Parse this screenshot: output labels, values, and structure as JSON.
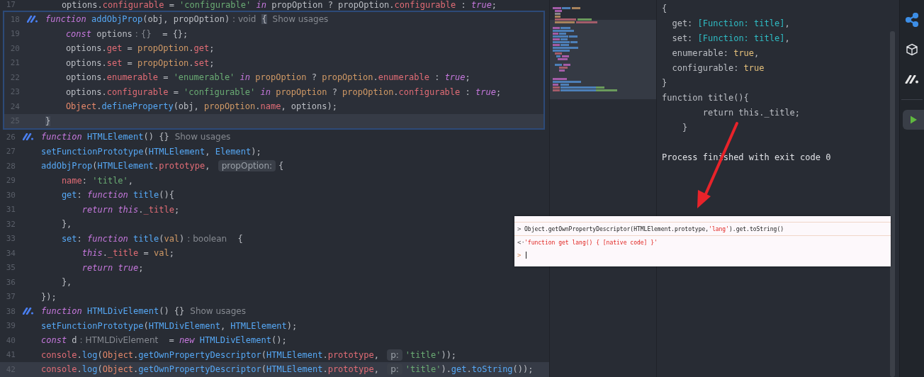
{
  "editor": {
    "top_line": {
      "number": "17",
      "tokens": [
        {
          "kind": "plain",
          "text": "    options."
        },
        {
          "kind": "prop",
          "text": "configurable"
        },
        {
          "kind": "plain",
          "text": " = "
        },
        {
          "kind": "str",
          "text": "'configurable'"
        },
        {
          "kind": "kw",
          "text": " in"
        },
        {
          "kind": "plain",
          "text": " propOption ? propOption."
        },
        {
          "kind": "prop",
          "text": "configurable"
        },
        {
          "kind": "plain",
          "text": " : "
        },
        {
          "kind": "kw",
          "text": "true"
        },
        {
          "kind": "plain",
          "text": ";"
        }
      ]
    },
    "popup_lines": [
      {
        "number": "18",
        "marker": true,
        "current": false,
        "tokens": [
          {
            "kind": "kw",
            "text": "function"
          },
          {
            "kind": "fn",
            "text": " addObjProp"
          },
          {
            "kind": "plain",
            "text": "(obj, propOption)"
          },
          {
            "kind": "hint",
            "text": ": void"
          },
          {
            "kind": "match",
            "text": "{"
          },
          {
            "kind": "usages",
            "text": "Show usages"
          }
        ]
      },
      {
        "number": "19",
        "marker": false,
        "current": false,
        "tokens": [
          {
            "kind": "kw",
            "text": "    const"
          },
          {
            "kind": "plain",
            "text": " options"
          },
          {
            "kind": "hint",
            "text": ": {}"
          },
          {
            "kind": "plain",
            "text": " = {};"
          }
        ]
      },
      {
        "number": "20",
        "marker": false,
        "current": false,
        "tokens": [
          {
            "kind": "plain",
            "text": "    options."
          },
          {
            "kind": "prop",
            "text": "get"
          },
          {
            "kind": "plain",
            "text": " = "
          },
          {
            "kind": "param",
            "text": "propOption"
          },
          {
            "kind": "plain",
            "text": "."
          },
          {
            "kind": "prop",
            "text": "get"
          },
          {
            "kind": "plain",
            "text": ";"
          }
        ]
      },
      {
        "number": "21",
        "marker": false,
        "current": false,
        "tokens": [
          {
            "kind": "plain",
            "text": "    options."
          },
          {
            "kind": "prop",
            "text": "set"
          },
          {
            "kind": "plain",
            "text": " = "
          },
          {
            "kind": "param",
            "text": "propOption"
          },
          {
            "kind": "plain",
            "text": "."
          },
          {
            "kind": "prop",
            "text": "set"
          },
          {
            "kind": "plain",
            "text": ";"
          }
        ]
      },
      {
        "number": "22",
        "marker": false,
        "current": false,
        "tokens": [
          {
            "kind": "plain",
            "text": "    options."
          },
          {
            "kind": "prop",
            "text": "enumerable"
          },
          {
            "kind": "plain",
            "text": " = "
          },
          {
            "kind": "str",
            "text": "'enumerable'"
          },
          {
            "kind": "kw",
            "text": " in"
          },
          {
            "kind": "param",
            "text": " propOption"
          },
          {
            "kind": "plain",
            "text": " ? "
          },
          {
            "kind": "param",
            "text": "propOption"
          },
          {
            "kind": "plain",
            "text": "."
          },
          {
            "kind": "prop",
            "text": "enumerable"
          },
          {
            "kind": "plain",
            "text": " : "
          },
          {
            "kind": "kw",
            "text": "true"
          },
          {
            "kind": "plain",
            "text": ";"
          }
        ]
      },
      {
        "number": "23",
        "marker": false,
        "current": false,
        "tokens": [
          {
            "kind": "plain",
            "text": "    options."
          },
          {
            "kind": "prop",
            "text": "configurable"
          },
          {
            "kind": "plain",
            "text": " = "
          },
          {
            "kind": "str",
            "text": "'configurable'"
          },
          {
            "kind": "kw",
            "text": " in"
          },
          {
            "kind": "param",
            "text": " propOption"
          },
          {
            "kind": "plain",
            "text": " ? "
          },
          {
            "kind": "param",
            "text": "propOption"
          },
          {
            "kind": "plain",
            "text": "."
          },
          {
            "kind": "prop",
            "text": "configurable"
          },
          {
            "kind": "plain",
            "text": " : "
          },
          {
            "kind": "kw",
            "text": "true"
          },
          {
            "kind": "plain",
            "text": ";"
          }
        ]
      },
      {
        "number": "24",
        "marker": false,
        "current": false,
        "tokens": [
          {
            "kind": "obj",
            "text": "    Object"
          },
          {
            "kind": "plain",
            "text": "."
          },
          {
            "kind": "fn",
            "text": "defineProperty"
          },
          {
            "kind": "plain",
            "text": "(obj, "
          },
          {
            "kind": "param",
            "text": "propOption"
          },
          {
            "kind": "plain",
            "text": "."
          },
          {
            "kind": "prop",
            "text": "name"
          },
          {
            "kind": "plain",
            "text": ", options);"
          }
        ]
      },
      {
        "number": "25",
        "marker": false,
        "current": true,
        "tokens": [
          {
            "kind": "match",
            "text": "}"
          }
        ]
      }
    ],
    "lines": [
      {
        "number": "26",
        "marker": true,
        "current": false,
        "tokens": [
          {
            "kind": "kw",
            "text": "function"
          },
          {
            "kind": "fn",
            "text": " HTMLElement"
          },
          {
            "kind": "plain",
            "text": "() {}"
          },
          {
            "kind": "usages",
            "text": "Show usages"
          }
        ]
      },
      {
        "number": "27",
        "marker": false,
        "current": false,
        "tokens": [
          {
            "kind": "fn",
            "text": "setFunctionPrototype"
          },
          {
            "kind": "plain",
            "text": "("
          },
          {
            "kind": "fn",
            "text": "HTMLElement"
          },
          {
            "kind": "plain",
            "text": ", "
          },
          {
            "kind": "fn",
            "text": "Element"
          },
          {
            "kind": "plain",
            "text": ");"
          }
        ]
      },
      {
        "number": "28",
        "marker": false,
        "current": false,
        "tokens": [
          {
            "kind": "fn",
            "text": "addObjProp"
          },
          {
            "kind": "plain",
            "text": "("
          },
          {
            "kind": "fn",
            "text": "HTMLElement"
          },
          {
            "kind": "plain",
            "text": "."
          },
          {
            "kind": "prop",
            "text": "prototype"
          },
          {
            "kind": "plain",
            "text": ", "
          },
          {
            "kind": "pill",
            "text": "propOption:"
          },
          {
            "kind": "plain",
            "text": "{"
          }
        ]
      },
      {
        "number": "29",
        "marker": false,
        "current": false,
        "tokens": [
          {
            "kind": "prop",
            "text": "    name"
          },
          {
            "kind": "plain",
            "text": ": "
          },
          {
            "kind": "str",
            "text": "'title'"
          },
          {
            "kind": "plain",
            "text": ","
          }
        ]
      },
      {
        "number": "30",
        "marker": false,
        "current": false,
        "tokens": [
          {
            "kind": "fn",
            "text": "    get"
          },
          {
            "kind": "plain",
            "text": ": "
          },
          {
            "kind": "kw",
            "text": "function"
          },
          {
            "kind": "fn",
            "text": " title"
          },
          {
            "kind": "plain",
            "text": "(){"
          }
        ]
      },
      {
        "number": "31",
        "marker": false,
        "current": false,
        "tokens": [
          {
            "kind": "kw",
            "text": "        return"
          },
          {
            "kind": "kw",
            "text": " this"
          },
          {
            "kind": "plain",
            "text": "."
          },
          {
            "kind": "prop",
            "text": "_title"
          },
          {
            "kind": "plain",
            "text": ";"
          }
        ]
      },
      {
        "number": "32",
        "marker": false,
        "current": false,
        "tokens": [
          {
            "kind": "plain",
            "text": "    },"
          }
        ]
      },
      {
        "number": "33",
        "marker": false,
        "current": false,
        "tokens": [
          {
            "kind": "fn",
            "text": "    set"
          },
          {
            "kind": "plain",
            "text": ": "
          },
          {
            "kind": "kw",
            "text": "function"
          },
          {
            "kind": "fn",
            "text": " title"
          },
          {
            "kind": "plain",
            "text": "("
          },
          {
            "kind": "param",
            "text": "val"
          },
          {
            "kind": "plain",
            "text": ")"
          },
          {
            "kind": "hint",
            "text": ": boolean"
          },
          {
            "kind": "plain",
            "text": " {"
          }
        ]
      },
      {
        "number": "34",
        "marker": false,
        "current": false,
        "tokens": [
          {
            "kind": "kw",
            "text": "        this"
          },
          {
            "kind": "plain",
            "text": "."
          },
          {
            "kind": "prop",
            "text": "_title"
          },
          {
            "kind": "plain",
            "text": " = "
          },
          {
            "kind": "param",
            "text": "val"
          },
          {
            "kind": "plain",
            "text": ";"
          }
        ]
      },
      {
        "number": "35",
        "marker": false,
        "current": false,
        "tokens": [
          {
            "kind": "kw",
            "text": "        return"
          },
          {
            "kind": "kw",
            "text": " true"
          },
          {
            "kind": "plain",
            "text": ";"
          }
        ]
      },
      {
        "number": "36",
        "marker": false,
        "current": false,
        "tokens": [
          {
            "kind": "plain",
            "text": "    },"
          }
        ]
      },
      {
        "number": "37",
        "marker": false,
        "current": false,
        "tokens": [
          {
            "kind": "plain",
            "text": "});"
          }
        ]
      },
      {
        "number": "38",
        "marker": true,
        "current": false,
        "tokens": [
          {
            "kind": "kw",
            "text": "function"
          },
          {
            "kind": "fn",
            "text": " HTMLDivElement"
          },
          {
            "kind": "plain",
            "text": "() {}"
          },
          {
            "kind": "usages",
            "text": "Show usages"
          }
        ]
      },
      {
        "number": "39",
        "marker": false,
        "current": false,
        "tokens": [
          {
            "kind": "fn",
            "text": "setFunctionPrototype"
          },
          {
            "kind": "plain",
            "text": "("
          },
          {
            "kind": "fn",
            "text": "HTMLDivElement"
          },
          {
            "kind": "plain",
            "text": ", "
          },
          {
            "kind": "fn",
            "text": "HTMLElement"
          },
          {
            "kind": "plain",
            "text": ");"
          }
        ]
      },
      {
        "number": "40",
        "marker": false,
        "current": false,
        "tokens": [
          {
            "kind": "kw",
            "text": "const"
          },
          {
            "kind": "plain",
            "text": " d"
          },
          {
            "kind": "hint",
            "text": ": HTMLDivElement"
          },
          {
            "kind": "plain",
            "text": " = "
          },
          {
            "kind": "kw",
            "text": "new"
          },
          {
            "kind": "fn",
            "text": " HTMLDivElement"
          },
          {
            "kind": "plain",
            "text": "();"
          }
        ]
      },
      {
        "number": "41",
        "marker": false,
        "current": false,
        "tokens": [
          {
            "kind": "prop",
            "text": "console"
          },
          {
            "kind": "plain",
            "text": "."
          },
          {
            "kind": "fn",
            "text": "log"
          },
          {
            "kind": "plain",
            "text": "("
          },
          {
            "kind": "obj",
            "text": "Object"
          },
          {
            "kind": "plain",
            "text": "."
          },
          {
            "kind": "fn",
            "text": "getOwnPropertyDescriptor"
          },
          {
            "kind": "plain",
            "text": "("
          },
          {
            "kind": "fn",
            "text": "HTMLElement"
          },
          {
            "kind": "plain",
            "text": "."
          },
          {
            "kind": "prop",
            "text": "prototype"
          },
          {
            "kind": "plain",
            "text": ", "
          },
          {
            "kind": "pill",
            "text": "p:"
          },
          {
            "kind": "str",
            "text": "'title'"
          },
          {
            "kind": "plain",
            "text": "));"
          }
        ]
      },
      {
        "number": "42",
        "marker": false,
        "current": true,
        "tokens": [
          {
            "kind": "prop",
            "text": "console"
          },
          {
            "kind": "plain",
            "text": "."
          },
          {
            "kind": "fn",
            "text": "log"
          },
          {
            "kind": "plain",
            "text": "("
          },
          {
            "kind": "obj",
            "text": "Object"
          },
          {
            "kind": "plain",
            "text": "."
          },
          {
            "kind": "fn",
            "text": "getOwnPropertyDescriptor"
          },
          {
            "kind": "plain",
            "text": "("
          },
          {
            "kind": "fn",
            "text": "HTMLElement"
          },
          {
            "kind": "plain",
            "text": "."
          },
          {
            "kind": "prop",
            "text": "prototype"
          },
          {
            "kind": "plain",
            "text": ", "
          },
          {
            "kind": "pill",
            "text": "p:"
          },
          {
            "kind": "str",
            "text": "'title'"
          },
          {
            "kind": "plain",
            "text": ")."
          },
          {
            "kind": "fn",
            "text": "get"
          },
          {
            "kind": "plain",
            "text": "."
          },
          {
            "kind": "fn",
            "text": "toString"
          },
          {
            "kind": "plain",
            "text": "());"
          }
        ]
      }
    ]
  },
  "console": {
    "lines": [
      [
        {
          "kind": "plain",
          "text": "{"
        }
      ],
      [
        {
          "kind": "plain",
          "text": "  get: "
        },
        {
          "kind": "ref",
          "text": "[Function: title]"
        },
        {
          "kind": "plain",
          "text": ","
        }
      ],
      [
        {
          "kind": "plain",
          "text": "  set: "
        },
        {
          "kind": "ref",
          "text": "[Function: title]"
        },
        {
          "kind": "plain",
          "text": ","
        }
      ],
      [
        {
          "kind": "plain",
          "text": "  enumerable: "
        },
        {
          "kind": "bool",
          "text": "true"
        },
        {
          "kind": "plain",
          "text": ","
        }
      ],
      [
        {
          "kind": "plain",
          "text": "  configurable: "
        },
        {
          "kind": "bool",
          "text": "true"
        }
      ],
      [
        {
          "kind": "plain",
          "text": "}"
        }
      ],
      [
        {
          "kind": "plain",
          "text": "function title(){"
        }
      ],
      [
        {
          "kind": "plain",
          "text": "        return this._title;"
        }
      ],
      [
        {
          "kind": "plain",
          "text": "    }"
        }
      ]
    ],
    "exit_message": "Process finished with exit code 0"
  },
  "devtools": {
    "entries": [
      {
        "kind": "input",
        "prompt": ">",
        "tokens": [
          {
            "kind": "plain",
            "text": "Object.getOwnPropertyDescriptor(HTMLElement.prototype,"
          },
          {
            "kind": "str",
            "text": "'lang'"
          },
          {
            "kind": "plain",
            "text": ").get.toString()"
          }
        ]
      },
      {
        "kind": "output",
        "prompt": "<·",
        "tokens": [
          {
            "kind": "str",
            "text": "'function get lang() { [native code] }'"
          }
        ]
      },
      {
        "kind": "prompt",
        "prompt": ">"
      }
    ]
  }
}
